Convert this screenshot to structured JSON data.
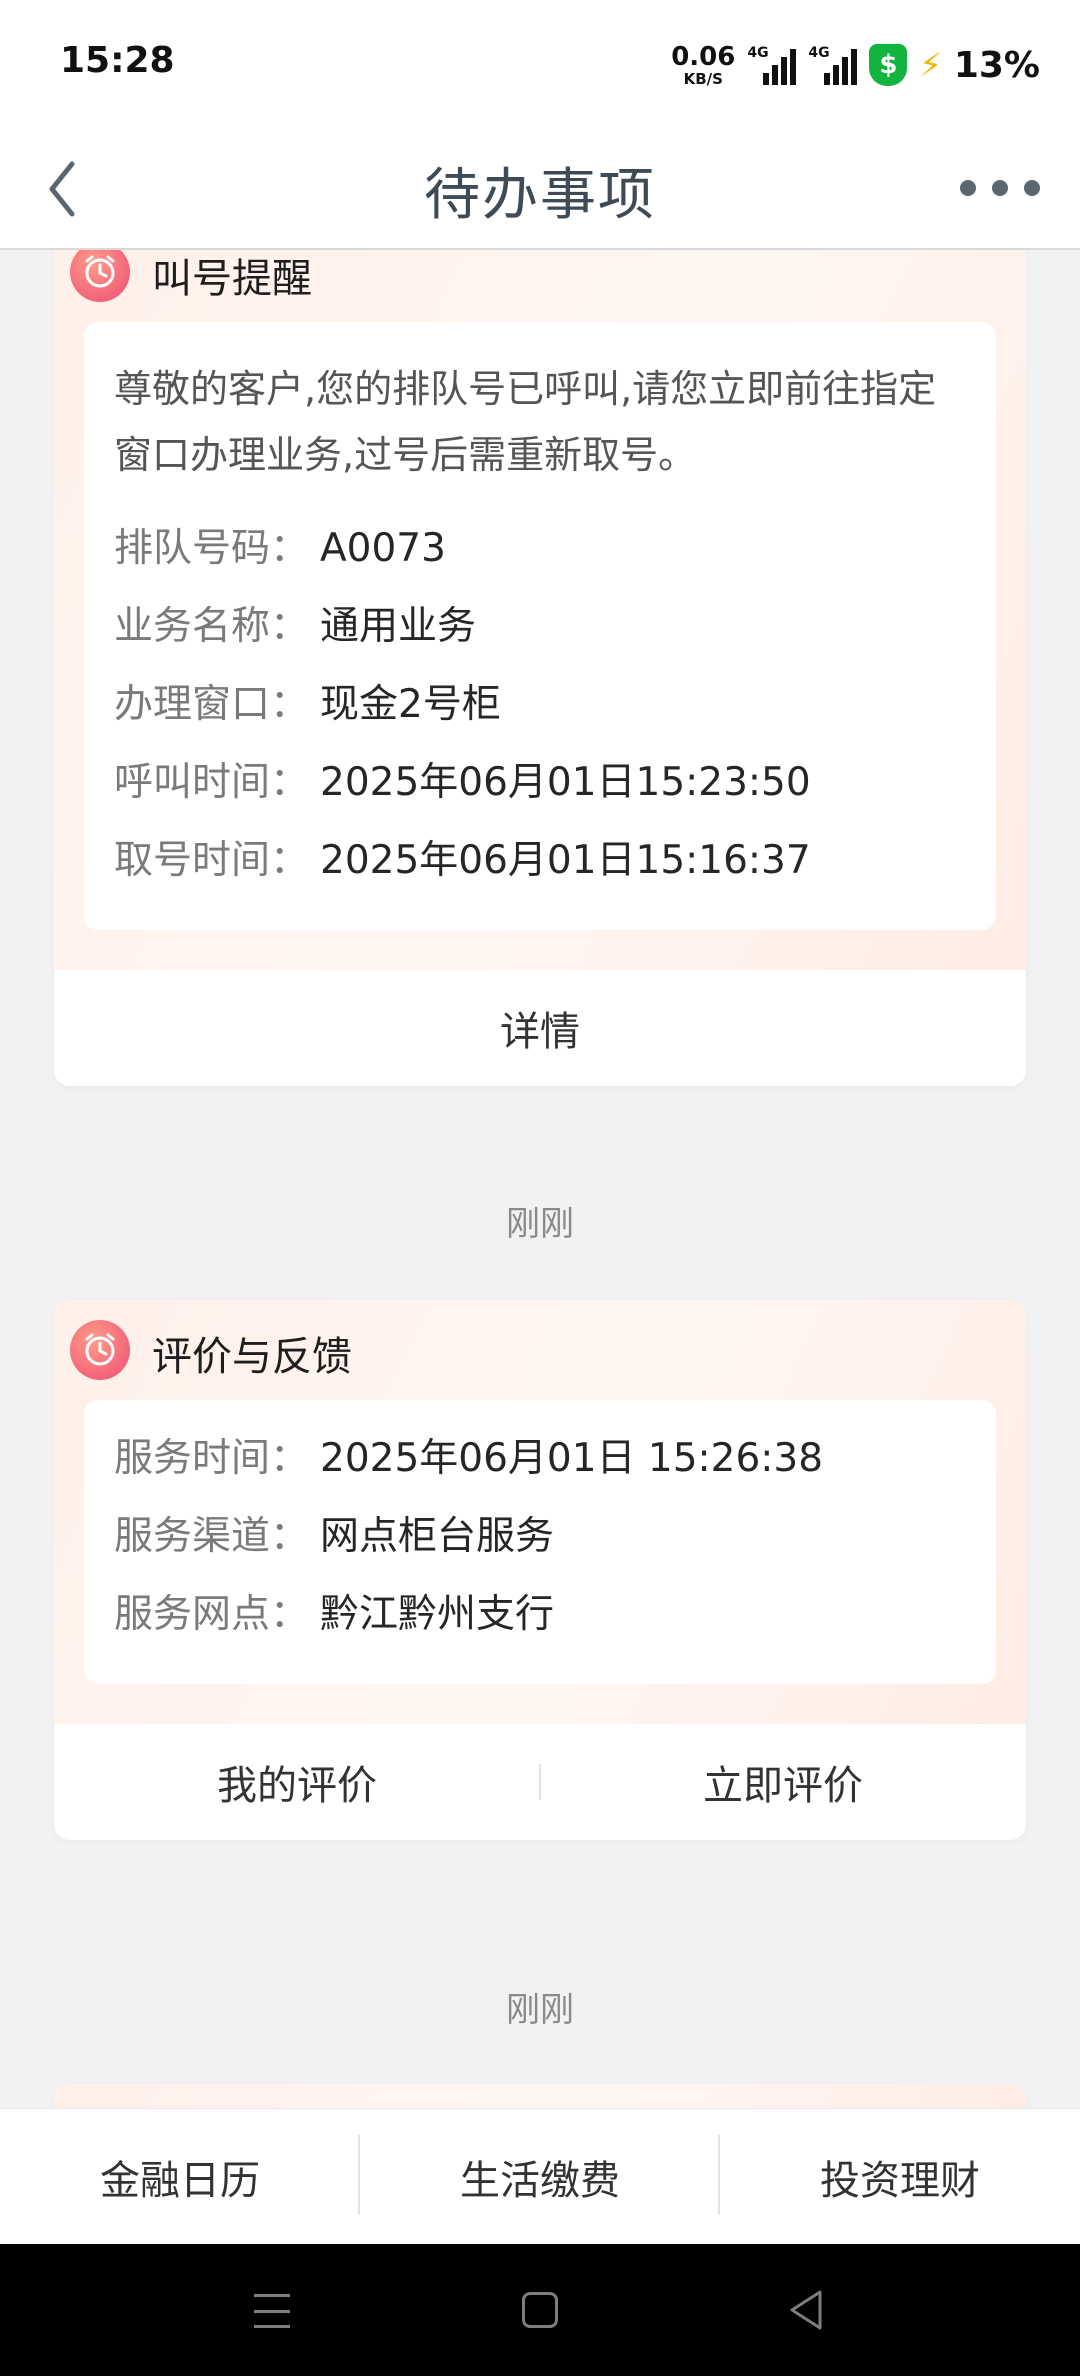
{
  "status_bar": {
    "time": "15:28",
    "net_speed_value": "0.06",
    "net_speed_unit": "KB/S",
    "signal1_tag": "4G",
    "signal2_tag": "4G",
    "shield_glyph": "$",
    "battery": "13%"
  },
  "nav": {
    "title": "待办事项"
  },
  "cards": [
    {
      "title": "叫号提醒",
      "message": "尊敬的客户,您的排队号已呼叫,请您立即前往指定窗口办理业务,过号后需重新取号。",
      "rows": [
        {
          "key": "排队号码：",
          "value": "A0073"
        },
        {
          "key": "业务名称：",
          "value": "通用业务"
        },
        {
          "key": "办理窗口：",
          "value": "现金2号柜"
        },
        {
          "key": "呼叫时间：",
          "value": "2025年06月01日15:23:50"
        },
        {
          "key": "取号时间：",
          "value": "2025年06月01日15:16:37"
        }
      ],
      "action": "详情"
    },
    {
      "title": "评价与反馈",
      "rows": [
        {
          "key": "服务时间：",
          "value": "2025年06月01日 15:26:38"
        },
        {
          "key": "服务渠道：",
          "value": "网点柜台服务"
        },
        {
          "key": "服务网点：",
          "value": "黔江黔州支行"
        }
      ],
      "actions": [
        "我的评价",
        "立即评价"
      ]
    }
  ],
  "time_labels": [
    "刚刚",
    "刚刚"
  ],
  "tab_bar": [
    "金融日历",
    "生活缴费",
    "投资理财"
  ],
  "colors": {
    "accent_icon": "#f2647a",
    "card_gradient": "#fff0e9",
    "page_bg": "#f2f2f4",
    "shield": "#13b33f"
  }
}
